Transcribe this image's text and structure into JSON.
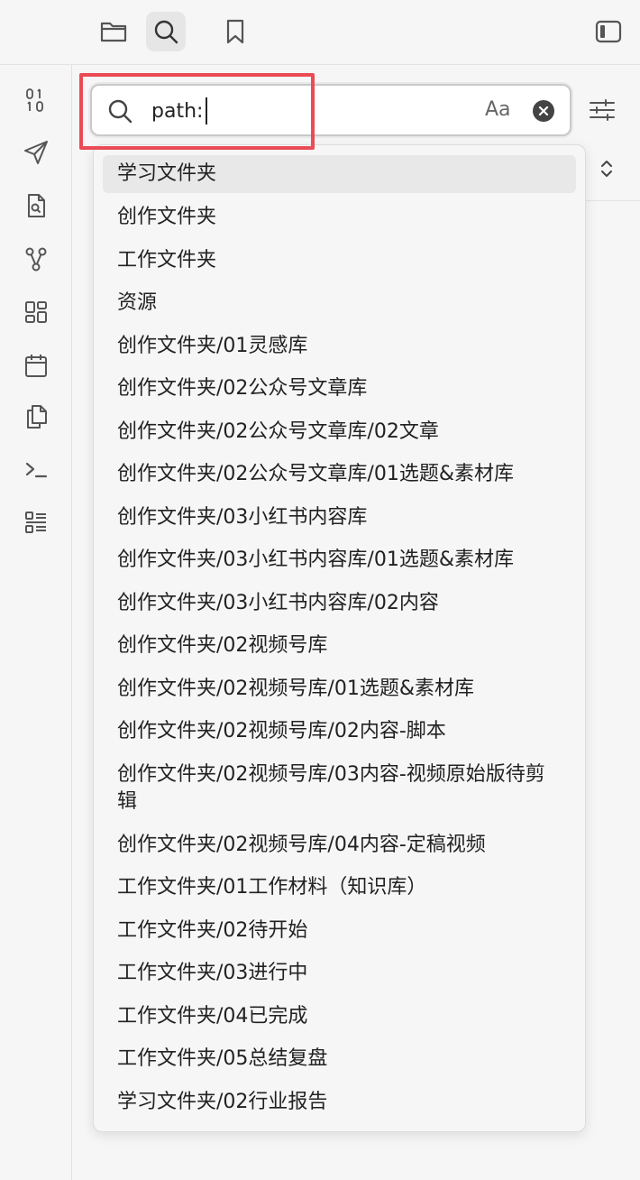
{
  "toolbar": {
    "tabs": [
      {
        "icon": "folder-icon"
      },
      {
        "icon": "search-icon",
        "active": true
      },
      {
        "icon": "bookmark-icon"
      }
    ],
    "right_icon": "sidebar-toggle-icon"
  },
  "ribbon": {
    "icons": [
      "binary-icon",
      "send-icon",
      "file-search-icon",
      "graph-icon",
      "layout-grid-icon",
      "calendar-icon",
      "copy-files-icon",
      "terminal-icon",
      "list-icon"
    ]
  },
  "search": {
    "value": "path:",
    "match_case_label": "Aa",
    "accent": "#ea4b55"
  },
  "suggestions": [
    "学习文件夹",
    "创作文件夹",
    "工作文件夹",
    "资源",
    "创作文件夹/01灵感库",
    "创作文件夹/02公众号文章库",
    "创作文件夹/02公众号文章库/02文章",
    "创作文件夹/02公众号文章库/01选题&素材库",
    "创作文件夹/03小红书内容库",
    "创作文件夹/03小红书内容库/01选题&素材库",
    "创作文件夹/03小红书内容库/02内容",
    "创作文件夹/02视频号库",
    "创作文件夹/02视频号库/01选题&素材库",
    "创作文件夹/02视频号库/02内容-脚本",
    "创作文件夹/02视频号库/03内容-视频原始版待剪辑",
    "创作文件夹/02视频号库/04内容-定稿视频",
    "工作文件夹/01工作材料（知识库）",
    "工作文件夹/02待开始",
    "工作文件夹/03进行中",
    "工作文件夹/04已完成",
    "工作文件夹/05总结复盘",
    "学习文件夹/02行业报告"
  ]
}
